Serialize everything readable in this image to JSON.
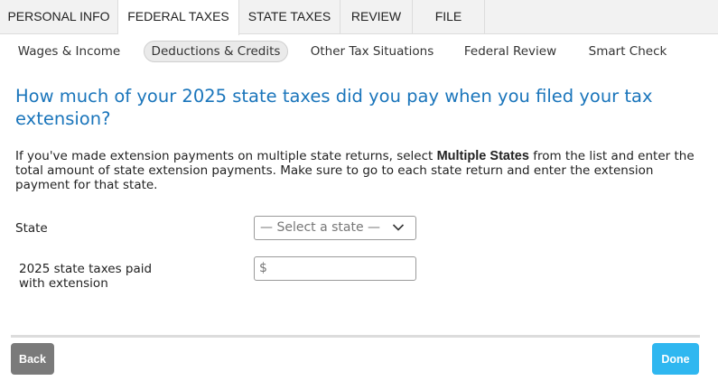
{
  "top_tabs": [
    {
      "label": "PERSONAL INFO"
    },
    {
      "label": "FEDERAL TAXES"
    },
    {
      "label": "STATE TAXES"
    },
    {
      "label": "REVIEW"
    },
    {
      "label": "FILE"
    }
  ],
  "active_top_tab": "FEDERAL TAXES",
  "sub_tabs": [
    {
      "label": "Wages & Income"
    },
    {
      "label": "Deductions & Credits"
    },
    {
      "label": "Other Tax Situations"
    },
    {
      "label": "Federal Review"
    },
    {
      "label": "Smart Check"
    }
  ],
  "active_sub_tab": "Deductions & Credits",
  "main": {
    "title": "How much of your 2025 state taxes did you pay when you filed your tax extension?",
    "intro": {
      "before": "If you've made extension payments on multiple state returns, select ",
      "bold": "Multiple States",
      "after": " from the list and enter the total amount of state extension payments. Make sure to go to each state return and enter the extension payment for that state."
    },
    "state_label": "State",
    "state_select": {
      "selected": "— Select a state —"
    },
    "paid_label_line1": "2025 state taxes paid",
    "paid_label_line2": "with extension",
    "paid_input": {
      "currency_symbol": "$",
      "value": ""
    }
  },
  "footer": {
    "back_label": "Back",
    "done_label": "Done"
  },
  "colors": {
    "title": "#1a75bb",
    "done_button": "#2fb7f0",
    "back_button": "#7a7a7a"
  },
  "icons": {
    "select_arrow": "chevron-down-icon"
  }
}
